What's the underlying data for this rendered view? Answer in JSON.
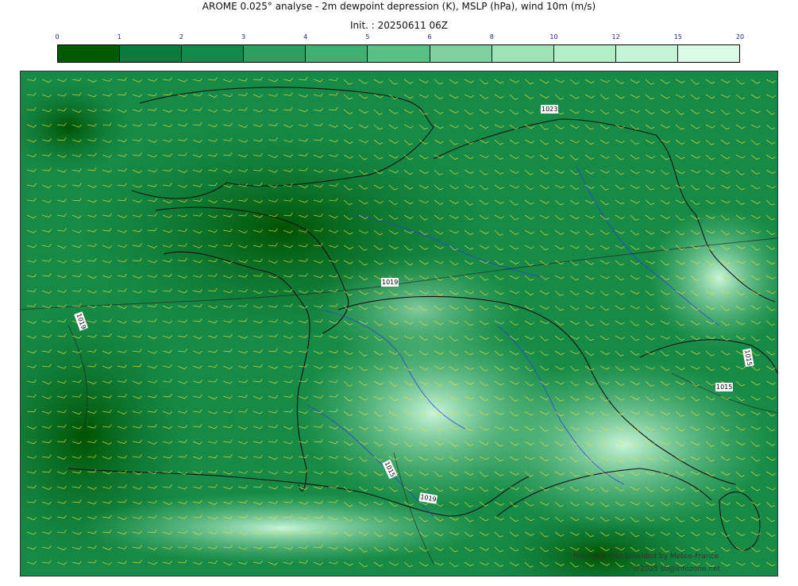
{
  "header": {
    "title": "AROME 0.025° analyse - 2m dewpoint depression (K), MSLP (hPa), wind 10m (m/s)",
    "init": "Init. : 20250611 06Z"
  },
  "colorbar": {
    "ticks": [
      "0",
      "1",
      "2",
      "3",
      "4",
      "5",
      "6",
      "8",
      "10",
      "12",
      "15",
      "20"
    ],
    "colors": [
      "#005a00",
      "#0b7a3a",
      "#13894a",
      "#2e9e5e",
      "#3fb070",
      "#58c083",
      "#7fd29f",
      "#9ee3b5",
      "#b2eec6",
      "#c6f4d6",
      "#dafbe6"
    ]
  },
  "map": {
    "isobar_labels": [
      "1023",
      "1019",
      "1019",
      "1015",
      "1015",
      "1015",
      "1019"
    ],
    "colors": {
      "moist": "#006000",
      "mid": "#1e9a52",
      "dry": "#b8f0cc",
      "wind": "#e7e03a",
      "rivers": "#2a3de0",
      "borders": "#111111"
    }
  },
  "credits": {
    "source": "from grib files provided by  Meteo-France",
    "copyright": "©2025 sb@infozone.net"
  }
}
